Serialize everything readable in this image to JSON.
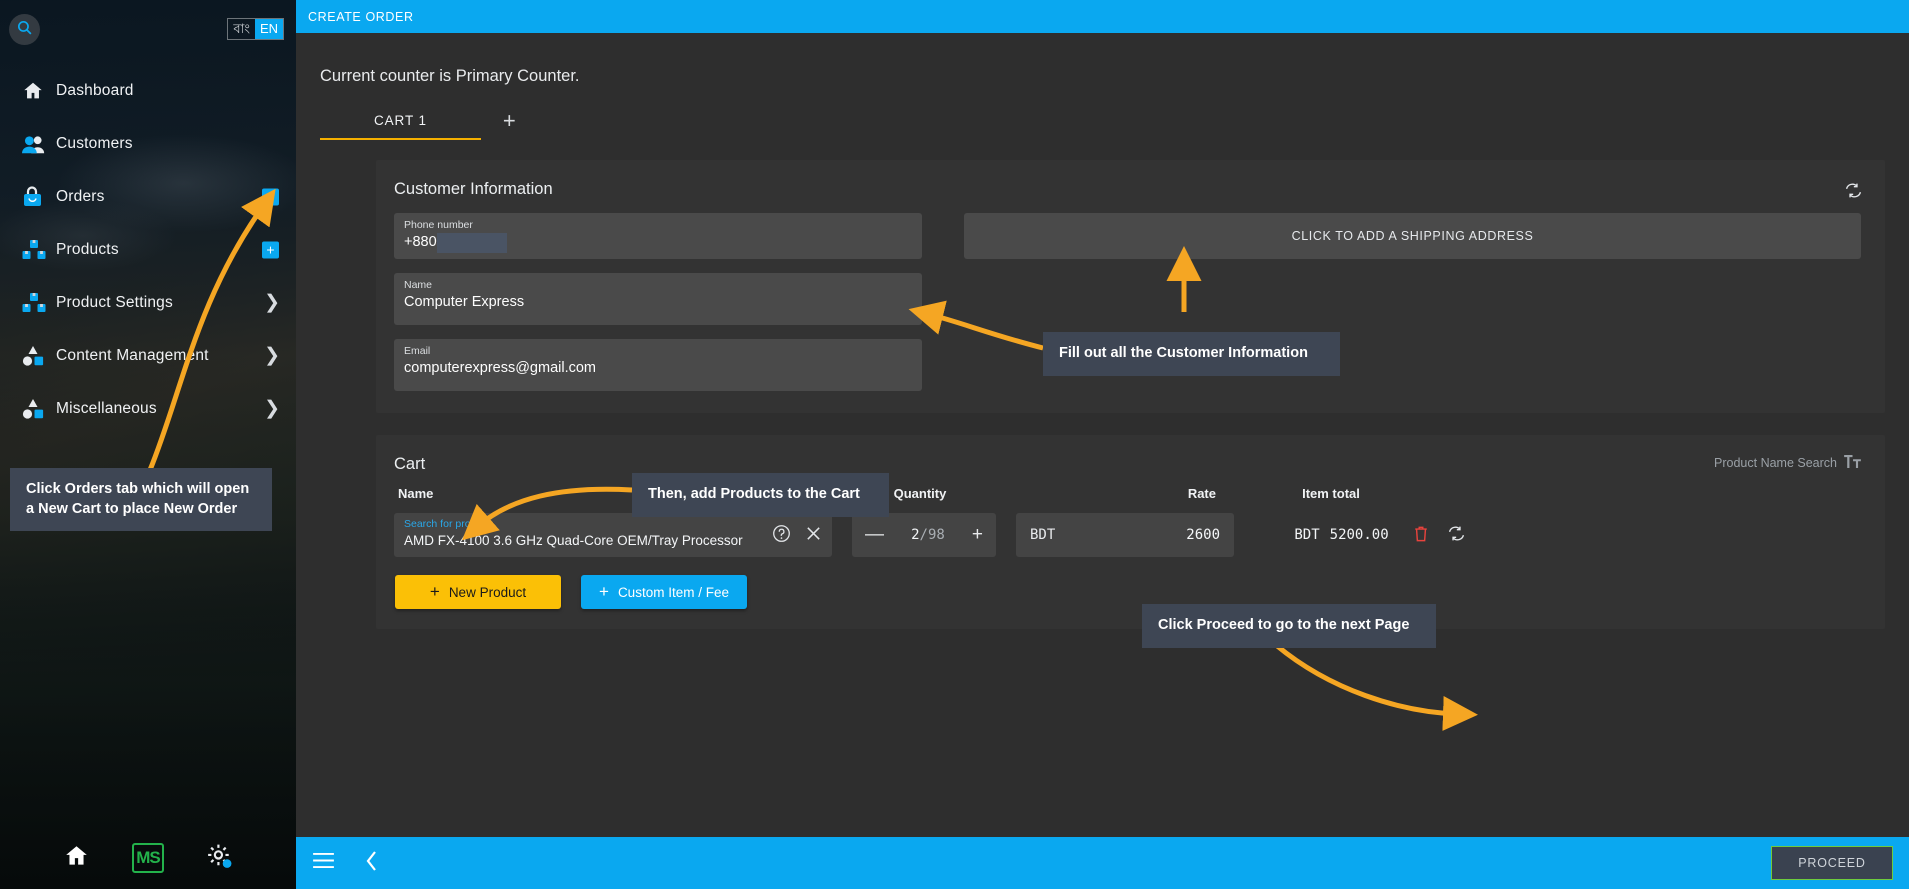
{
  "sidebar": {
    "search_icon": "search-icon",
    "language": {
      "options": [
        "বাং",
        "EN"
      ],
      "selected": "EN"
    },
    "items": [
      {
        "label": "Dashboard",
        "icon": "home-icon",
        "badge": null,
        "chevron": false
      },
      {
        "label": "Customers",
        "icon": "users-icon",
        "badge": null,
        "chevron": false
      },
      {
        "label": "Orders",
        "icon": "bag-icon",
        "badge": "+",
        "chevron": false
      },
      {
        "label": "Products",
        "icon": "boxes-icon",
        "badge": "+",
        "chevron": false
      },
      {
        "label": "Product Settings",
        "icon": "boxes-icon",
        "badge": null,
        "chevron": true
      },
      {
        "label": "Content Management",
        "icon": "shapes-icon",
        "badge": null,
        "chevron": true
      },
      {
        "label": "Miscellaneous",
        "icon": "shapes-icon",
        "badge": null,
        "chevron": true
      }
    ],
    "bottom": {
      "home_icon": "home-icon",
      "logo_text": "MS",
      "settings_icon": "gear-icon"
    }
  },
  "topbar": {
    "title": "CREATE ORDER"
  },
  "page": {
    "counter_text": "Current counter is Primary Counter.",
    "tabs": [
      {
        "label": "CART 1"
      }
    ],
    "add_tab_label": "+"
  },
  "customer": {
    "title": "Customer Information",
    "refresh_icon": "refresh-icon",
    "phone": {
      "label": "Phone number",
      "value": "+880",
      "placeholder": "Phone number"
    },
    "name": {
      "label": "Name",
      "value": "Computer Express",
      "placeholder": "Name"
    },
    "email": {
      "label": "Email",
      "value": "computerexpress@gmail.com",
      "placeholder": "Email"
    },
    "shipping_button": "CLICK TO ADD A SHIPPING ADDRESS"
  },
  "cart": {
    "title": "Cart",
    "search_mode_label": "Product Name Search",
    "search_mode_icon": "text-format-icon",
    "columns": {
      "name": "Name",
      "quantity": "Quantity",
      "rate": "Rate",
      "item_total": "Item total"
    },
    "rows": [
      {
        "product_label": "Search for product",
        "product_value": "AMD FX-4100 3.6 GHz Quad-Core OEM/Tray Processor",
        "help_icon": "help-circle-icon",
        "clear_icon": "close-icon",
        "minus_label": "—",
        "plus_label": "+",
        "quantity": "2",
        "quantity_max": "/98",
        "currency": "BDT",
        "rate": "2600",
        "item_total_currency": "BDT",
        "item_total": "5200.00",
        "delete_icon": "trash-icon",
        "refresh_icon": "refresh-icon"
      }
    ],
    "new_product_button": "New Product",
    "custom_item_button": "Custom Item / Fee",
    "plus_glyph": "+"
  },
  "bottombar": {
    "menu_icon": "hamburger-icon",
    "back_icon": "chevron-left-icon",
    "proceed_label": "PROCEED"
  },
  "annotations": [
    {
      "text": "Click Orders tab which will open a New Cart to place New Order"
    },
    {
      "text": "Fill out all the Customer Information"
    },
    {
      "text": "Then, add Products to the Cart"
    },
    {
      "text": "Click Proceed to go to the next Page"
    }
  ],
  "colors": {
    "accent": "#0aa8f0",
    "highlight": "#f5b000",
    "arrow": "#f5a623",
    "danger": "#e8433d",
    "success": "#23b24b"
  }
}
